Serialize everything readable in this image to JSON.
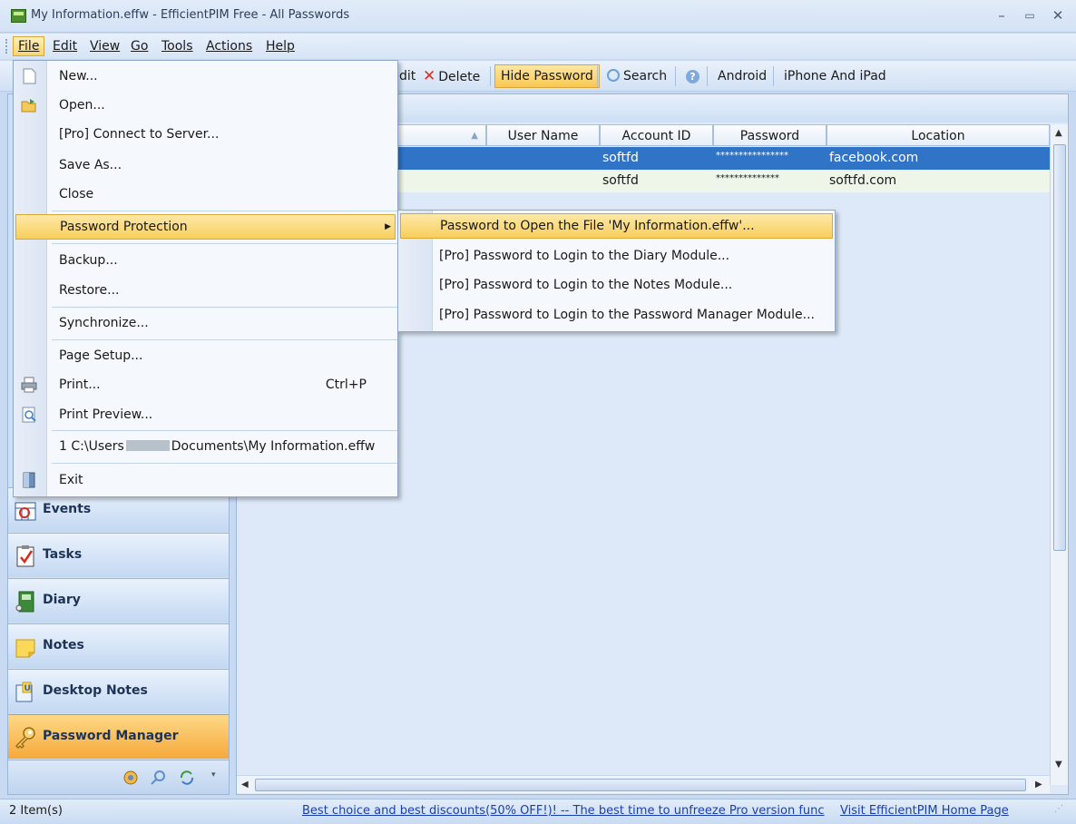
{
  "window": {
    "title": "My Information.effw - EfficientPIM Free - All Passwords",
    "controls": [
      "–",
      "▭",
      "✕"
    ]
  },
  "menubar": [
    {
      "label": "File",
      "active": true
    },
    {
      "label": "Edit"
    },
    {
      "label": "View"
    },
    {
      "label": "Go"
    },
    {
      "label": "Tools"
    },
    {
      "label": "Actions"
    },
    {
      "label": "Help"
    }
  ],
  "toolbar": {
    "edit_fragment": "dit",
    "delete": "Delete",
    "hide_password": "Hide Password",
    "search": "Search",
    "help_glyph": "?",
    "android": "Android",
    "iphone": "iPhone And iPad"
  },
  "table": {
    "columns": [
      "User Name",
      "Account ID",
      "Password",
      "Location"
    ],
    "rows": [
      {
        "user": "",
        "account": "softfd",
        "password": "****************",
        "location": "facebook.com",
        "selected": true
      },
      {
        "user": "",
        "account": "softfd",
        "password": "**************",
        "location": "softfd.com",
        "selected": false
      }
    ]
  },
  "file_menu": {
    "new": "New...",
    "open": "Open...",
    "connect": "[Pro] Connect to Server...",
    "save_as": "Save As...",
    "close": "Close",
    "password_protection": "Password Protection",
    "backup": "Backup...",
    "restore": "Restore...",
    "synchronize": "Synchronize...",
    "page_setup": "Page Setup...",
    "print": "Print...",
    "print_shortcut": "Ctrl+P",
    "print_preview": "Print Preview...",
    "recent_prefix": "1 C:\\Users",
    "recent_suffix": "Documents\\My Information.effw",
    "exit": "Exit"
  },
  "submenu": {
    "open_file": "Password to Open the File 'My Information.effw'...",
    "diary": "[Pro] Password to Login to the Diary Module...",
    "notes": "[Pro] Password to Login to the Notes Module...",
    "password_manager": "[Pro] Password to Login to the Password Manager Module..."
  },
  "nav": {
    "events": "Events",
    "tasks": "Tasks",
    "diary": "Diary",
    "notes": "Notes",
    "desktop_notes": "Desktop Notes",
    "password_manager": "Password Manager"
  },
  "statusbar": {
    "count": "2 Item(s)",
    "promo": "Best choice and best discounts(50% OFF!)! -- The best time to unfreeze Pro version func",
    "visit": "Visit EfficientPIM Home Page"
  },
  "colors": {
    "accent_orange": "#f6a93a",
    "selection_blue": "#3074c8",
    "menu_highlight": "#f8cf5d"
  }
}
